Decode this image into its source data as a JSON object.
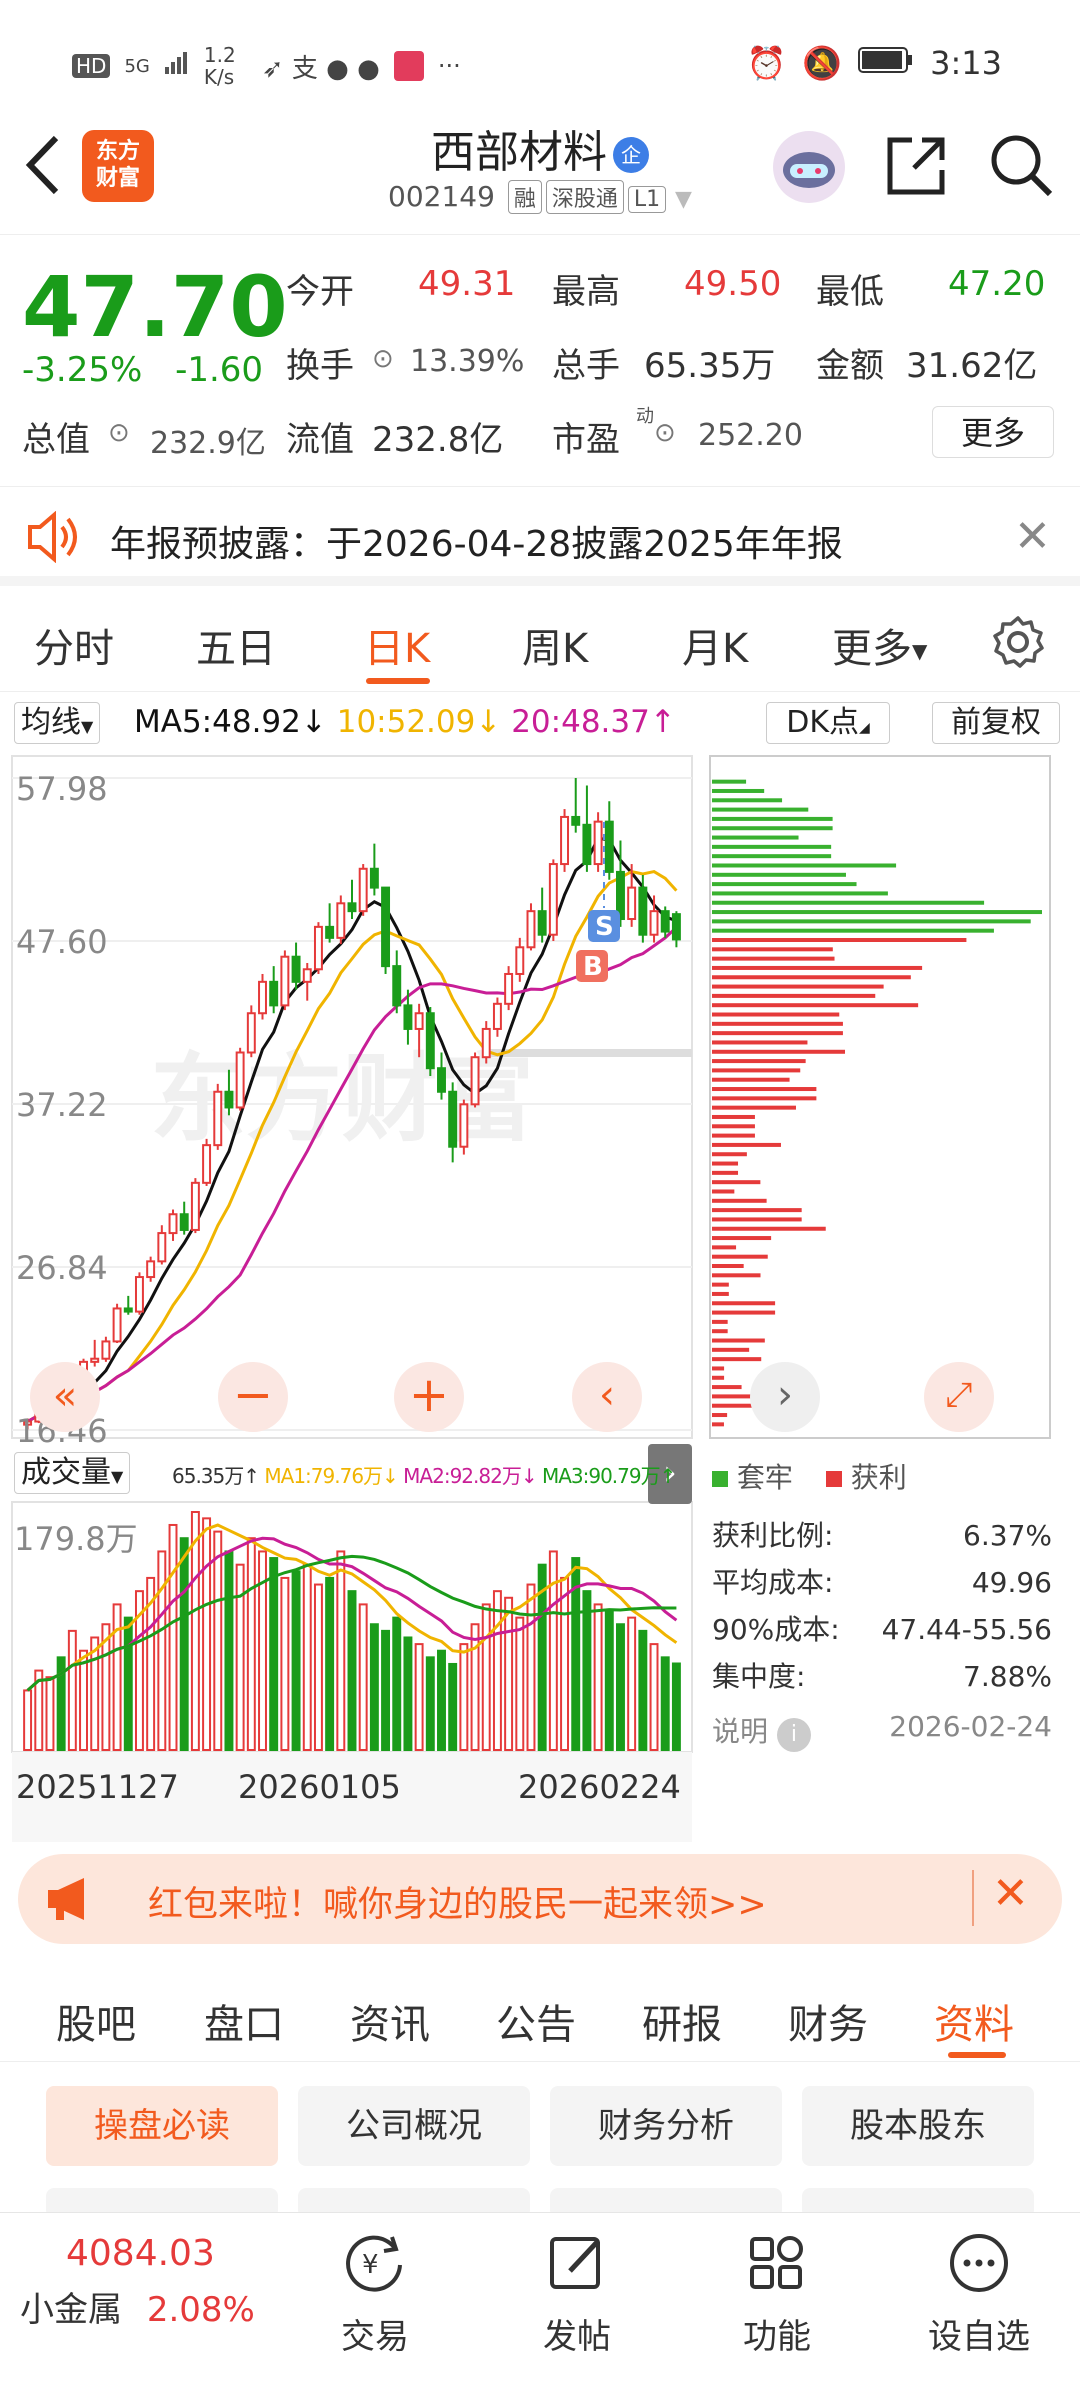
{
  "status_bar": {
    "left_items": [
      "HD",
      "5G",
      "1.2 K/s"
    ],
    "time": "3:13"
  },
  "header": {
    "back_icon": "chevron-left-icon",
    "logo_text_1": "东方",
    "logo_text_2": "财富",
    "stock_name": "西部材料",
    "enterprise_badge": "企",
    "stock_code": "002149",
    "tags": [
      "融",
      "深股通",
      "L1"
    ]
  },
  "quote": {
    "price": "47.70",
    "change_pct": "-3.25%",
    "change": "-1.60",
    "open_label": "今开",
    "open": "49.31",
    "high_label": "最高",
    "high": "49.50",
    "low_label": "最低",
    "low": "47.20",
    "turnover_label": "换手",
    "turnover": "13.39%",
    "volume_label": "总手",
    "volume": "65.35万",
    "amount_label": "金额",
    "amount": "31.62亿",
    "total_value_label": "总值",
    "total_value": "232.9亿",
    "float_value_label": "流值",
    "float_value": "232.8亿",
    "pe_label": "市盈",
    "pe_sup": "动",
    "pe": "252.20",
    "more_button": "更多"
  },
  "notice": {
    "text": "年报预披露：于2026-04-28披露2025年年报"
  },
  "chart_tabs": {
    "items": [
      "分时",
      "五日",
      "日K",
      "周K",
      "月K",
      "更多"
    ],
    "active": "日K"
  },
  "kline": {
    "ma_selector": "均线",
    "ma5": "MA5:48.92",
    "ma10": "10:52.09",
    "ma20": "20:48.37",
    "dk_button": "DK点",
    "adjust_button": "前复权",
    "y_ticks": [
      "57.98",
      "47.60",
      "37.22",
      "26.84",
      "16.46"
    ],
    "marker_s": "S",
    "marker_b": "B",
    "watermark": "东方财富"
  },
  "volume": {
    "selector": "成交量",
    "vol": "65.35万",
    "ma1": "MA1:79.76万",
    "ma2": "MA2:92.82万",
    "ma3": "MA3:90.79万",
    "y_max": "179.8万",
    "x_dates": [
      "20251127",
      "20260105",
      "20260224"
    ]
  },
  "chip_distribution": {
    "legend_locked": "套牢",
    "legend_profit": "获利",
    "profit_ratio_label": "获利比例:",
    "profit_ratio": "6.37%",
    "avg_cost_label": "平均成本:",
    "avg_cost": "49.96",
    "cost90_label": "90%成本:",
    "cost90": "47.44-55.56",
    "concentration_label": "集中度:",
    "concentration": "7.88%",
    "explain_label": "说明",
    "date": "2026-02-24"
  },
  "chart_data": {
    "type": "candlestick",
    "y_range": [
      16.46,
      57.98
    ],
    "ohlc": [
      [
        16.8,
        17.2,
        16.5,
        17.0
      ],
      [
        17.0,
        18.0,
        16.9,
        17.8
      ],
      [
        17.8,
        18.6,
        17.5,
        18.3
      ],
      [
        18.3,
        18.8,
        17.8,
        18.0
      ],
      [
        18.0,
        19.5,
        17.9,
        19.3
      ],
      [
        19.3,
        21.0,
        19.0,
        20.8
      ],
      [
        20.8,
        22.2,
        20.5,
        21.0
      ],
      [
        21.0,
        22.4,
        20.8,
        22.1
      ],
      [
        22.1,
        24.5,
        22.0,
        24.2
      ],
      [
        24.2,
        25.0,
        23.8,
        24.0
      ],
      [
        24.0,
        26.5,
        23.8,
        26.2
      ],
      [
        26.2,
        27.5,
        25.9,
        27.2
      ],
      [
        27.2,
        29.5,
        27.0,
        29.0
      ],
      [
        29.0,
        30.5,
        28.5,
        30.2
      ],
      [
        30.2,
        31.0,
        28.9,
        29.2
      ],
      [
        29.2,
        32.5,
        29.0,
        32.2
      ],
      [
        32.2,
        35.0,
        32.0,
        34.6
      ],
      [
        34.6,
        38.5,
        34.3,
        38.0
      ],
      [
        38.0,
        39.4,
        36.5,
        37.0
      ],
      [
        37.0,
        40.8,
        36.8,
        40.5
      ],
      [
        40.5,
        43.5,
        40.2,
        43.0
      ],
      [
        43.0,
        45.5,
        42.6,
        45.0
      ],
      [
        45.0,
        46.0,
        43.0,
        43.5
      ],
      [
        43.5,
        47.0,
        43.2,
        46.6
      ],
      [
        46.6,
        47.5,
        44.5,
        45.0
      ],
      [
        45.0,
        46.2,
        43.8,
        45.8
      ],
      [
        45.8,
        48.8,
        45.5,
        48.5
      ],
      [
        48.5,
        50.0,
        47.5,
        47.8
      ],
      [
        47.8,
        50.5,
        47.4,
        50.0
      ],
      [
        50.0,
        51.5,
        49.0,
        49.5
      ],
      [
        49.5,
        52.5,
        49.2,
        52.2
      ],
      [
        52.2,
        53.8,
        50.5,
        51.0
      ],
      [
        51.0,
        49.0,
        45.5,
        46.0
      ],
      [
        46.0,
        47.0,
        43.0,
        43.5
      ],
      [
        43.5,
        44.5,
        41.0,
        42.0
      ],
      [
        42.0,
        43.6,
        40.2,
        43.0
      ],
      [
        43.0,
        43.4,
        39.0,
        39.5
      ],
      [
        39.5,
        40.5,
        37.5,
        38.0
      ],
      [
        38.0,
        38.6,
        33.5,
        34.5
      ],
      [
        34.5,
        37.5,
        34.0,
        37.2
      ],
      [
        37.2,
        40.5,
        37.0,
        40.2
      ],
      [
        40.2,
        42.5,
        39.8,
        42.0
      ],
      [
        42.0,
        44.0,
        41.5,
        43.6
      ],
      [
        43.6,
        46.0,
        43.2,
        45.5
      ],
      [
        45.5,
        47.8,
        45.0,
        47.2
      ],
      [
        47.2,
        50.0,
        47.0,
        49.5
      ],
      [
        49.5,
        51.0,
        47.5,
        48.0
      ],
      [
        48.0,
        52.8,
        47.6,
        52.5
      ],
      [
        52.5,
        56.0,
        52.0,
        55.5
      ],
      [
        55.5,
        57.98,
        54.5,
        55.0
      ],
      [
        55.0,
        57.5,
        52.0,
        52.5
      ],
      [
        52.5,
        55.8,
        52.0,
        55.2
      ],
      [
        55.2,
        56.5,
        51.5,
        52.0
      ],
      [
        52.0,
        54.0,
        48.5,
        49.0
      ],
      [
        49.0,
        52.5,
        48.5,
        51.0
      ],
      [
        51.0,
        51.8,
        47.5,
        48.0
      ],
      [
        48.0,
        50.5,
        47.5,
        49.5
      ],
      [
        49.5,
        49.8,
        47.8,
        48.2
      ],
      [
        49.31,
        49.5,
        47.2,
        47.7
      ]
    ],
    "volume": [
      45,
      60,
      55,
      70,
      90,
      75,
      85,
      95,
      110,
      100,
      120,
      130,
      150,
      170,
      160,
      179.8,
      175,
      165,
      150,
      140,
      160,
      150,
      145,
      130,
      135,
      140,
      125,
      130,
      150,
      120,
      110,
      95,
      90,
      100,
      85,
      80,
      70,
      75,
      65,
      80,
      95,
      110,
      120,
      115,
      100,
      125,
      140,
      150,
      130,
      145,
      120,
      110,
      105,
      95,
      100,
      90,
      80,
      70,
      65.35
    ],
    "ma5": 48.92,
    "ma10": 52.09,
    "ma20": 48.37
  },
  "banner": {
    "text": "红包来啦！喊你身边的股民一起来领>>"
  },
  "f10_tabs": {
    "items": [
      "股吧",
      "盘口",
      "资讯",
      "公告",
      "研报",
      "财务",
      "资料"
    ],
    "active": "资料"
  },
  "chips": {
    "items": [
      "操盘必读",
      "公司概况",
      "财务分析",
      "股本股东"
    ]
  },
  "bottom_bar": {
    "index_value": "4084.03",
    "index_name": "小金属",
    "index_change": "2.08%",
    "items": [
      {
        "label": "交易",
        "icon": "yuan-refresh-icon"
      },
      {
        "label": "发帖",
        "icon": "edit-icon"
      },
      {
        "label": "功能",
        "icon": "grid-icon"
      },
      {
        "label": "设自选",
        "icon": "more-circle-icon"
      }
    ]
  },
  "colors": {
    "up": "#e53a3a",
    "down": "#1a9c1a",
    "brand": "#f25a1e",
    "ma5": "#111111",
    "ma10": "#f0b400",
    "ma20": "#c81e96"
  }
}
